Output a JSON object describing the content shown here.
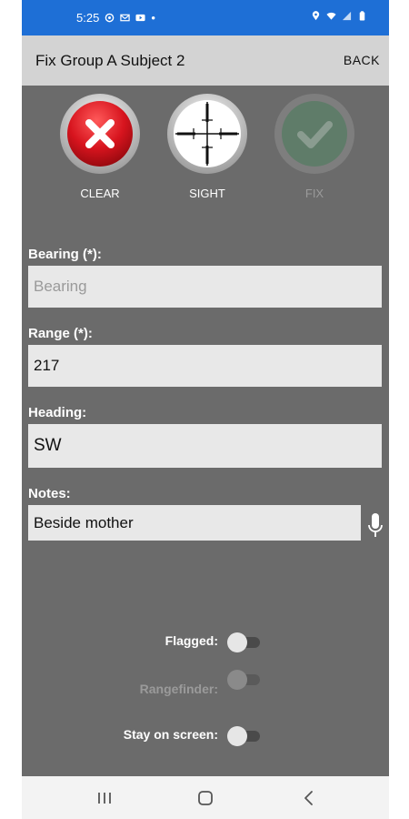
{
  "status_bar": {
    "time": "5:25",
    "dot": "•"
  },
  "app_bar": {
    "title": "Fix Group A Subject 2",
    "back_label": "BACK"
  },
  "actions": {
    "clear_label": "CLEAR",
    "sight_label": "SIGHT",
    "fix_label": "FIX"
  },
  "form": {
    "bearing": {
      "label": "Bearing (*):",
      "value": "",
      "placeholder": "Bearing"
    },
    "range": {
      "label": "Range (*):",
      "value": "217"
    },
    "heading": {
      "label": "Heading:",
      "value": "SW"
    },
    "notes": {
      "label": "Notes:",
      "value": "Beside mother"
    }
  },
  "toggles": {
    "flagged": {
      "label": "Flagged:",
      "on": false,
      "enabled": true
    },
    "rangefinder": {
      "label": "Rangefinder:",
      "on": false,
      "enabled": false
    },
    "stay_on_screen": {
      "label": "Stay on screen:",
      "on": false,
      "enabled": true
    }
  },
  "colors": {
    "status_bar": "#1e6fd6",
    "app_bar": "#d3d3d3",
    "background": "#6b6b6b",
    "clear_red": "#d7141e",
    "fix_green": "#5f7c69"
  },
  "icons": [
    "location-icon",
    "mail-icon",
    "video-icon",
    "wifi-icon",
    "signal-icon",
    "battery-icon",
    "mic-icon",
    "recents-icon",
    "home-icon",
    "back-nav-icon"
  ]
}
